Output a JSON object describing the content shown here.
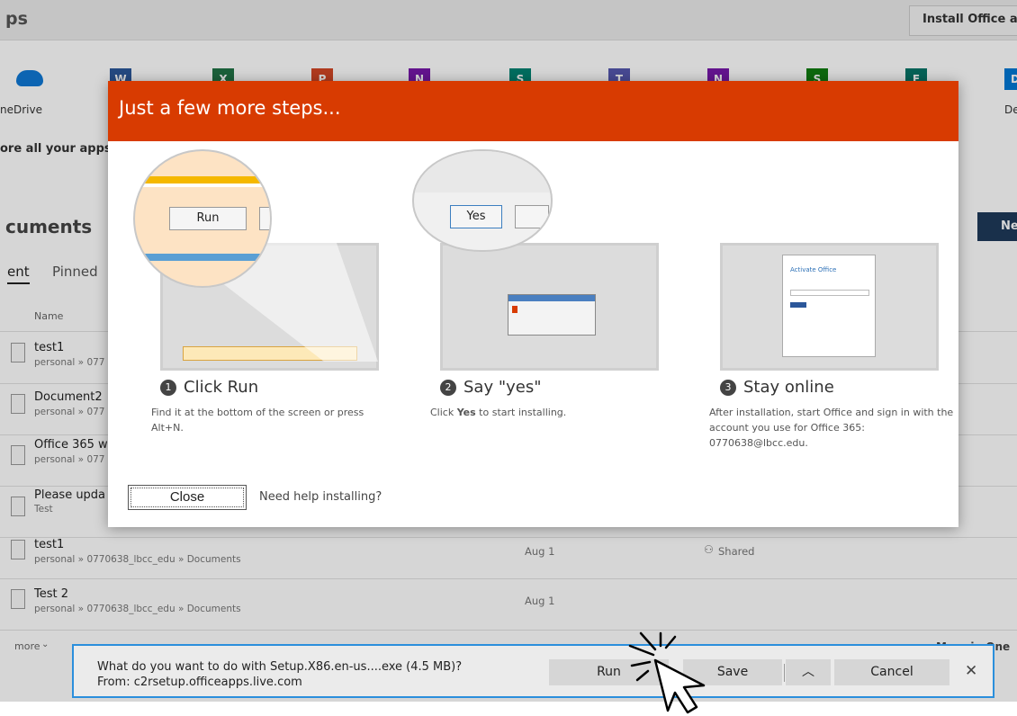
{
  "header": {
    "title_partial": "ps",
    "install_button": "Install Office ap"
  },
  "apps": {
    "tiles": [
      {
        "name": "onedrive",
        "color": "#0f78d4",
        "letter": ""
      },
      {
        "name": "word",
        "color": "#2b579a",
        "letter": "W"
      },
      {
        "name": "excel",
        "color": "#217346",
        "letter": "X"
      },
      {
        "name": "powerpoint",
        "color": "#d24726",
        "letter": "P"
      },
      {
        "name": "onenote",
        "color": "#7719aa",
        "letter": "N"
      },
      {
        "name": "sway",
        "color": "#008272",
        "letter": "S"
      },
      {
        "name": "teams",
        "color": "#5558af",
        "letter": "T"
      },
      {
        "name": "class-notebook",
        "color": "#7719aa",
        "letter": "N"
      },
      {
        "name": "staff-hub",
        "color": "#107c10",
        "letter": "S"
      },
      {
        "name": "forms",
        "color": "#077568",
        "letter": "F"
      },
      {
        "name": "delve",
        "color": "#0078d4",
        "letter": "D"
      }
    ],
    "onedrive_label": "neDrive",
    "right_label": "De",
    "explore_link": "ore all your apps"
  },
  "documents": {
    "heading": "cuments",
    "tabs": [
      "ent",
      "Pinned"
    ],
    "name_col": "Name",
    "new_button": "Ne",
    "rows": [
      {
        "title": "test1",
        "sub": "personal » 077"
      },
      {
        "title": "Document2",
        "sub": "personal » 077"
      },
      {
        "title": "Office 365 w",
        "sub": "personal » 077"
      },
      {
        "title": "Please upda",
        "sub": "Test"
      },
      {
        "title": "test1",
        "sub": "personal » 0770638_lbcc_edu » Documents",
        "date": "Aug 1",
        "shared": "Shared"
      },
      {
        "title": "Test 2",
        "sub": "personal » 0770638_lbcc_edu » Documents",
        "date": "Aug 1"
      }
    ],
    "more_link": "more",
    "more_right": "More in One"
  },
  "modal": {
    "title": "Just a few more steps...",
    "run_label": "Run",
    "yes_label": "Yes",
    "activate_title": "Activate Office",
    "steps": [
      {
        "num": "1",
        "title": "Click Run",
        "desc": "Find it at the bottom of the screen or press Alt+N."
      },
      {
        "num": "2",
        "title": "Say \"yes\"",
        "desc_pre": "Click ",
        "desc_bold": "Yes",
        "desc_post": " to start installing."
      },
      {
        "num": "3",
        "title": "Stay online",
        "desc": "After installation, start Office and sign in with the account you use for Office 365: 0770638@lbcc.edu."
      }
    ],
    "close_label": "Close",
    "help_link": "Need help installing?"
  },
  "download_bar": {
    "line1": "What do you want to do with Setup.X86.en-us....exe (4.5 MB)?",
    "line2": "From: c2rsetup.officeapps.live.com",
    "run": "Run",
    "save": "Save",
    "cancel": "Cancel"
  },
  "colors": {
    "office_orange": "#d83b01",
    "download_bar_border": "#2b8fdc"
  }
}
